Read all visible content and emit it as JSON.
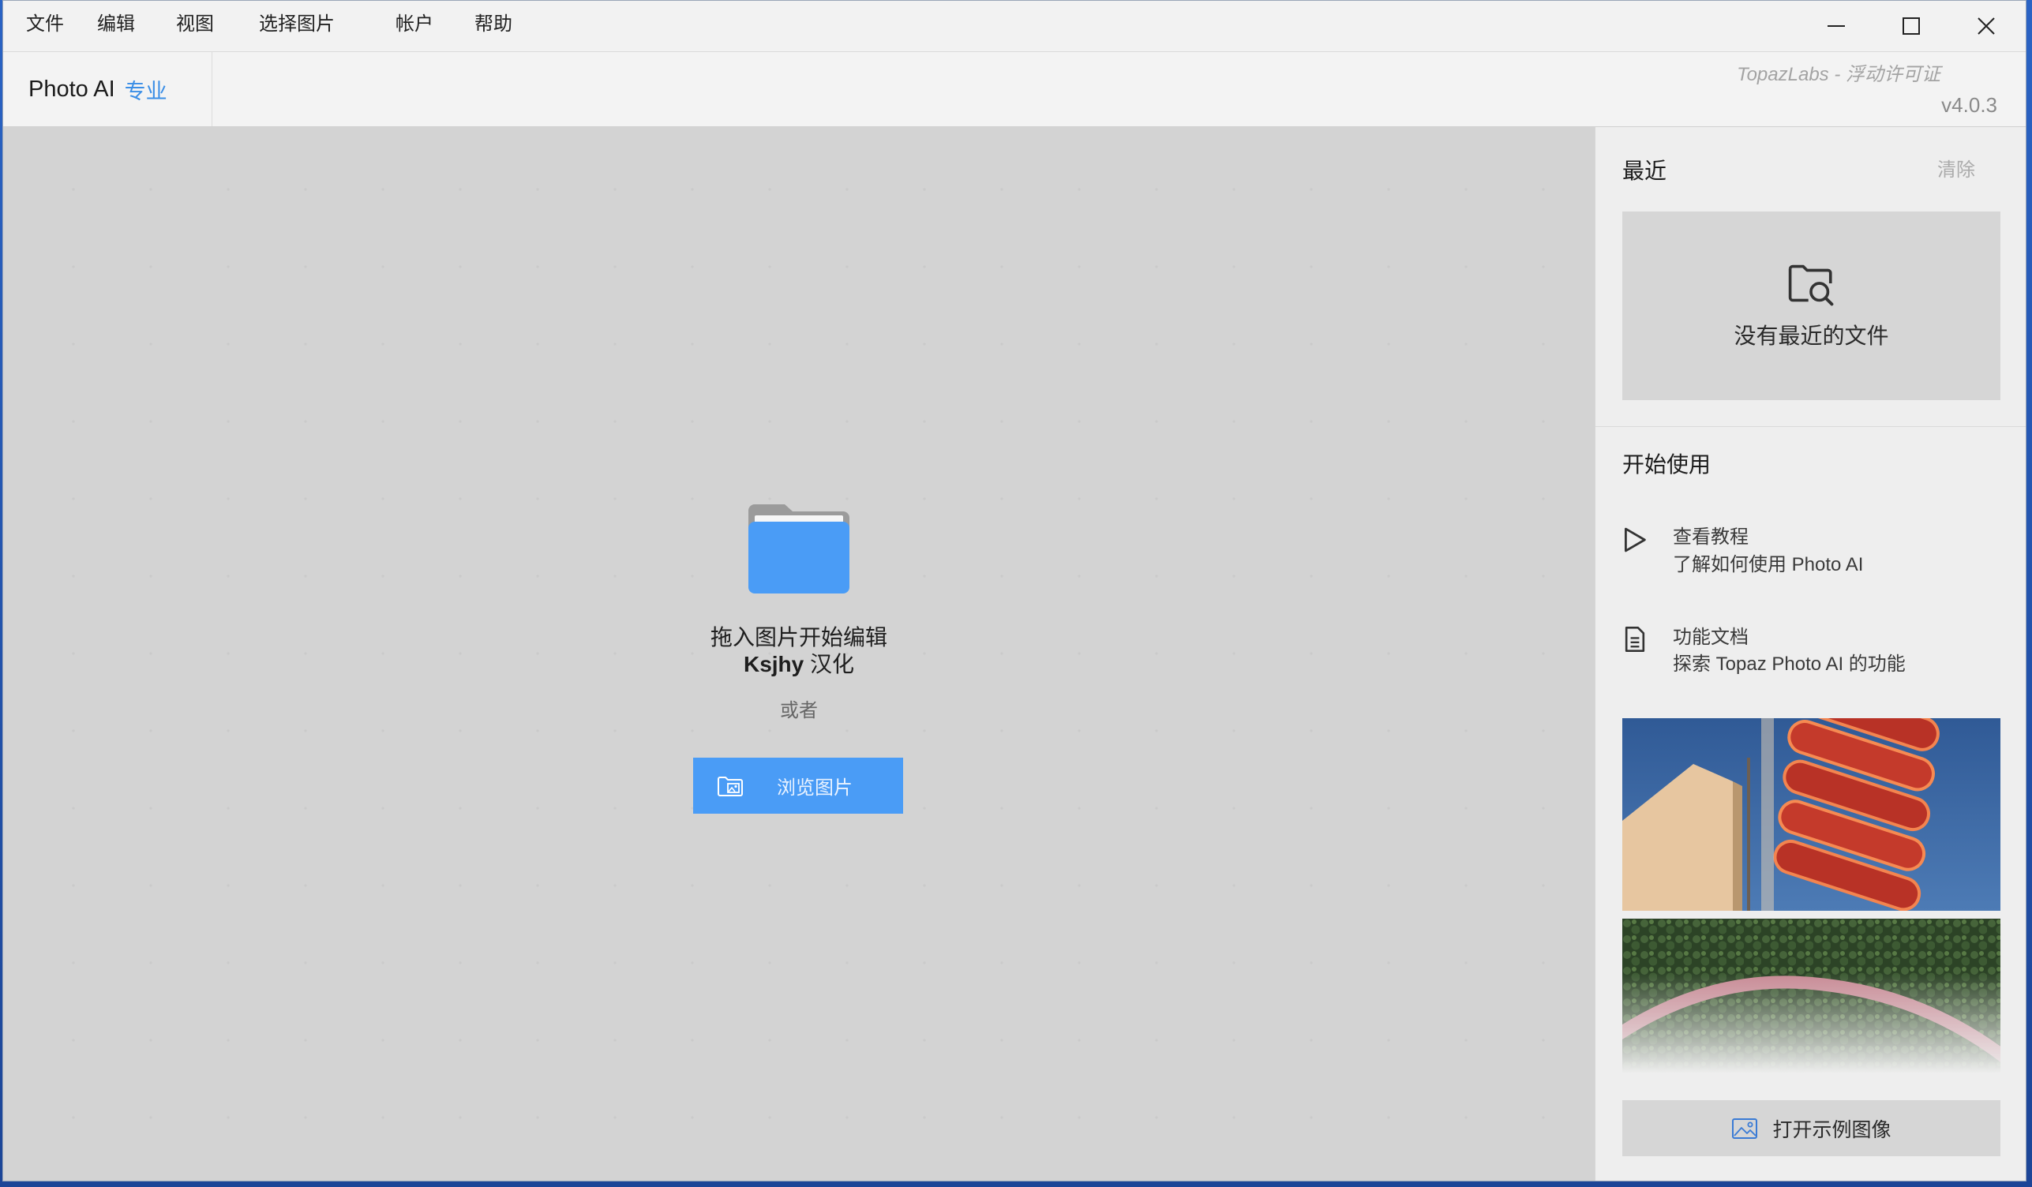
{
  "menu": {
    "items": [
      "文件",
      "编辑",
      "视图",
      "选择图片",
      "帐户",
      "帮助"
    ]
  },
  "window_controls": {
    "minimize_icon": "minimize-icon",
    "maximize_icon": "maximize-icon",
    "close_icon": "close-icon"
  },
  "header": {
    "app_name": "Photo AI",
    "edition": "专业",
    "license": "TopazLabs - 浮动许可证",
    "version": "v4.0.3"
  },
  "dropzone": {
    "icon": "folder-icon",
    "line1": "拖入图片开始编辑",
    "line2_bold": "Ksjhy",
    "line2_rest": "汉化",
    "or_text": "或者",
    "browse_label": "浏览图片",
    "browse_icon": "image-folder-icon"
  },
  "recent": {
    "title": "最近",
    "clear_label": "清除",
    "empty_icon": "folder-search-icon",
    "empty_text": "没有最近的文件"
  },
  "getting_started": {
    "title": "开始使用",
    "items": [
      {
        "icon": "play-icon",
        "title": "查看教程",
        "subtitle": "了解如何使用 Photo AI"
      },
      {
        "icon": "document-icon",
        "title": "功能文档",
        "subtitle": "探索 Topaz Photo AI 的功能"
      }
    ]
  },
  "samples": {
    "open_label": "打开示例图像",
    "open_icon": "image-icon"
  },
  "colors": {
    "accent": "#4a9cf6",
    "edition_text": "#3a8ee6",
    "main_bg": "#d3d3d3",
    "sidebar_bg": "#eeeeee"
  }
}
